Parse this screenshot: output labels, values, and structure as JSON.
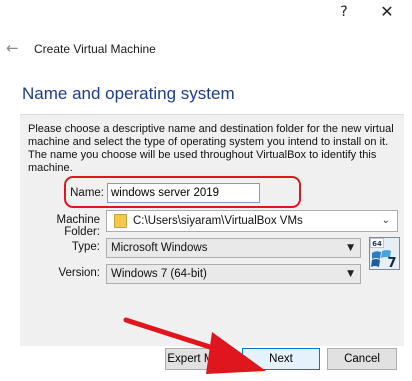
{
  "titlebar": {
    "help_glyph": "?",
    "close_glyph": "✕"
  },
  "wizard": {
    "back_glyph": "←",
    "title": "Create Virtual Machine"
  },
  "section": {
    "heading": "Name and operating system",
    "description": "Please choose a descriptive name and destination folder for the new virtual machine and select the type of operating system you intend to install on it. The name you choose will be used throughout VirtualBox to identify this machine."
  },
  "form": {
    "name_label": "Name:",
    "name_value": "windows server 2019",
    "folder_label": "Machine Folder:",
    "folder_value": "C:\\Users\\siyaram\\VirtualBox VMs",
    "type_label": "Type:",
    "type_value": "Microsoft Windows",
    "version_label": "Version:",
    "version_value": "Windows 7 (64-bit)",
    "os_badge_bits": "64",
    "os_badge_version": "7"
  },
  "buttons": {
    "expert_mode": "Expert Mode",
    "next": "Next",
    "cancel": "Cancel"
  },
  "colors": {
    "heading": "#1f3c88",
    "annotation_red": "#e0161f",
    "default_button_border": "#0078d7"
  }
}
